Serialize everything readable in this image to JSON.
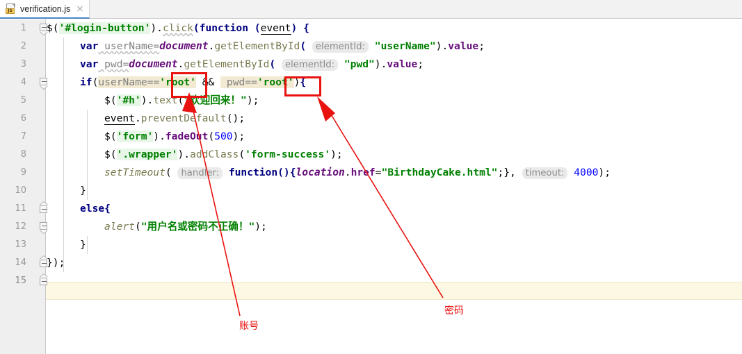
{
  "window": {
    "title": "verification.js"
  },
  "tab": {
    "label": "verification.js",
    "icon": "javascript-file-icon",
    "badge": "JS",
    "close_icon": "close-icon"
  },
  "editor": {
    "line_numbers": [
      "1",
      "2",
      "3",
      "4",
      "5",
      "6",
      "7",
      "8",
      "9",
      "10",
      "11",
      "12",
      "13",
      "14",
      "15"
    ],
    "current_line": 15,
    "fold_markers": [
      {
        "line": 1,
        "type": "start"
      },
      {
        "line": 4,
        "type": "start"
      },
      {
        "line": 10,
        "type": "end"
      },
      {
        "line": 11,
        "type": "start"
      },
      {
        "line": 13,
        "type": "end"
      },
      {
        "line": 14,
        "type": "end"
      }
    ],
    "lines": {
      "l1_a": "$(",
      "l1_b": "'#login-button'",
      "l1_c": ")",
      "l1_d": ".",
      "l1_e": "click",
      "l1_f": "(",
      "l1_g": "function",
      "l1_h": " (",
      "l1_i": "event",
      "l1_j": ") {",
      "l2_kw": "var",
      "l2_name": " userName=",
      "l2_obj": "document",
      "l2_dot": ".",
      "l2_call": "getElementById",
      "l2_open": "( ",
      "l2_inlay": "elementId:",
      "l2_str": " \"userName\"",
      "l2_close": ").",
      "l2_prop": "value",
      "l2_semi": ";",
      "l3_kw": "var",
      "l3_name": " pwd=",
      "l3_obj": "document",
      "l3_dot": ".",
      "l3_call": "getElementById",
      "l3_open": "( ",
      "l3_inlay": "elementId:",
      "l3_str": " \"pwd\"",
      "l3_close": ").",
      "l3_prop": "value",
      "l3_semi": ";",
      "l4_if": "if",
      "l4_p1": "(",
      "l4_cond1_var": "userName==",
      "l4_cond1_str": "'root'",
      "l4_amp": " && ",
      "l4_cond2_var": " pwd==",
      "l4_cond2_str": "'root'",
      "l4_p2": ")",
      "l4_brace": "{",
      "l5_a": "$(",
      "l5_b": "'#h'",
      "l5_c": ").",
      "l5_d": "text",
      "l5_e": "(",
      "l5_f": "\"欢迎回来！\"",
      "l5_g": ");",
      "l6_a": "event",
      "l6_b": ".",
      "l6_c": "preventDefault",
      "l6_d": "();",
      "l7_a": "$(",
      "l7_b": "'form'",
      "l7_c": ").",
      "l7_d": "fadeOut",
      "l7_e": "(",
      "l7_f": "500",
      "l7_g": ");",
      "l8_a": "$(",
      "l8_b": "'.wrapper'",
      "l8_c": ").",
      "l8_d": "addClass",
      "l8_e": "(",
      "l8_f": "'form-success'",
      "l8_g": ");",
      "l9_a": "setTimeout",
      "l9_b": "( ",
      "l9_inlay1": "handler:",
      "l9_c": " function",
      "l9_d": "(){",
      "l9_e": "location",
      "l9_f": ".",
      "l9_g": "href",
      "l9_h": "=",
      "l9_i": "\"BirthdayCake.html\"",
      "l9_j": ";}, ",
      "l9_inlay2": "timeout:",
      "l9_k": " ",
      "l9_l": "4000",
      "l9_m": ");",
      "l10": "}",
      "l11_a": "else",
      "l11_b": "{",
      "l12_a": "alert",
      "l12_b": "(",
      "l12_c": "\"用户名或密码不正确！\"",
      "l12_d": ");",
      "l13": "}",
      "l14": "});",
      "l15": ""
    }
  },
  "annotations": {
    "box1_name": "root-username-highlight-box",
    "box2_name": "root-password-highlight-box",
    "label_account": "账号",
    "label_password": "密码",
    "arrow1_name": "arrow-to-username",
    "arrow2_name": "arrow-to-password",
    "color": "#e8120f"
  }
}
